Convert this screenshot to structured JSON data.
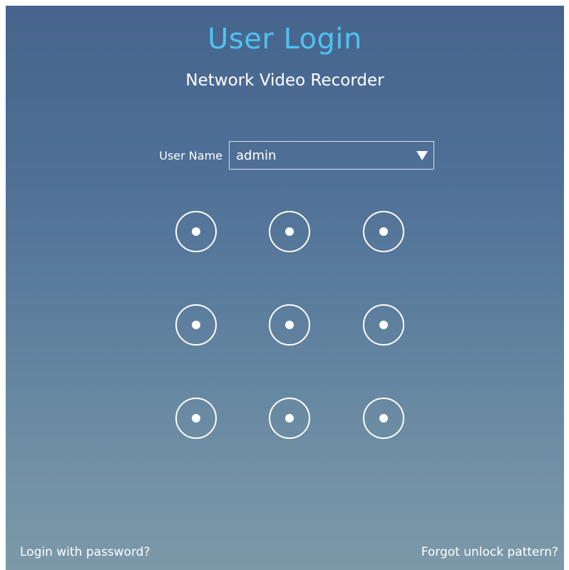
{
  "header": {
    "title": "User Login",
    "subtitle": "Network Video Recorder"
  },
  "form": {
    "user_label": "User Name",
    "user_value": "admin"
  },
  "pattern": {
    "rows": 3,
    "cols": 3
  },
  "footer": {
    "login_with_password": "Login with password?",
    "forgot_pattern": "Forgot unlock pattern?"
  },
  "colors": {
    "title": "#4ec3f0",
    "text": "#ffffff"
  }
}
